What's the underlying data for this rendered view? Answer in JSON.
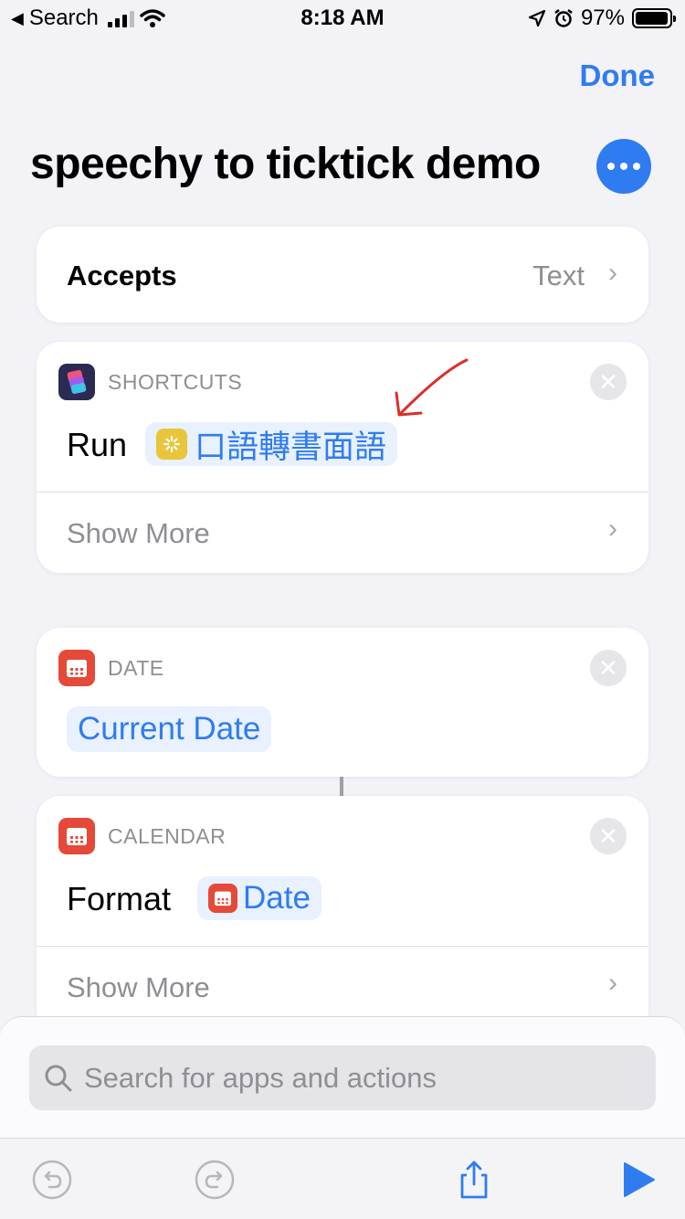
{
  "status_bar": {
    "back_label": "Search",
    "time": "8:18 AM",
    "battery": "97%",
    "battery_level": 0.97,
    "icons": [
      "back-arrow-icon",
      "signal-icon",
      "wifi-icon",
      "location-icon",
      "alarm-icon",
      "battery-icon"
    ]
  },
  "header": {
    "done_label": "Done",
    "title": "speechy to ticktick demo",
    "more_icon": "more-icon"
  },
  "accepts": {
    "label": "Accepts",
    "value": "Text"
  },
  "actions": [
    {
      "category": "SHORTCUTS",
      "icon": "shortcuts-icon",
      "verb": "Run",
      "token": "口語轉書面語",
      "token_icon": "sparkle-icon",
      "show_more": "Show More"
    },
    {
      "category": "DATE",
      "icon": "calendar-icon",
      "token": "Current Date"
    },
    {
      "category": "CALENDAR",
      "icon": "calendar-icon",
      "verb": "Format",
      "token": "Date",
      "token_icon": "calendar-icon",
      "show_more": "Show More"
    }
  ],
  "search": {
    "placeholder": "Search for apps and actions"
  },
  "toolbar": {
    "icons": [
      "undo-icon",
      "redo-icon",
      "share-icon",
      "play-icon"
    ]
  },
  "colors": {
    "accent": "#2f7cf0",
    "background": "#f2f2f7",
    "calendar_red": "#e5493a",
    "token_bg": "#e8f1fd",
    "annotation_red": "#d9302b"
  }
}
